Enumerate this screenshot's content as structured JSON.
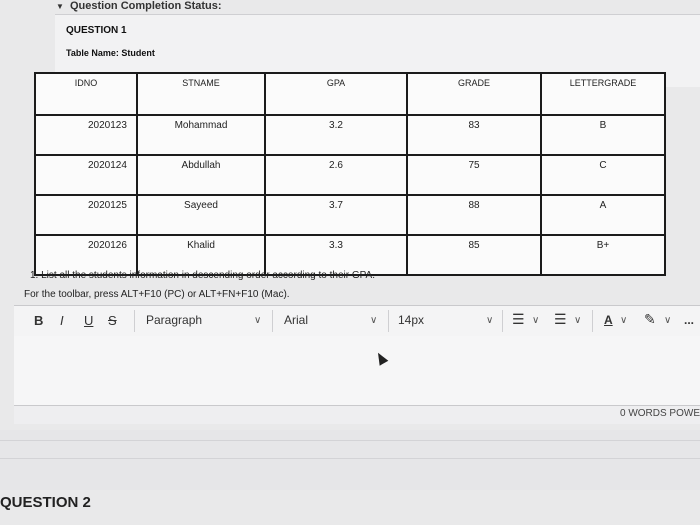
{
  "status": {
    "label": "Question Completion Status:"
  },
  "question": {
    "title": "QUESTION 1",
    "table_name": "Table Name: Student",
    "prompt": "1. List all the students information in descending order according to their GPA.",
    "toolbar_hint": "For the toolbar, press ALT+F10 (PC) or ALT+FN+F10 (Mac)."
  },
  "table": {
    "headers": [
      "IDNO",
      "STNAME",
      "GPA",
      "GRADE",
      "LETTERGRADE"
    ],
    "rows": [
      [
        "2020123",
        "Mohammad",
        "3.2",
        "83",
        "B"
      ],
      [
        "2020124",
        "Abdullah",
        "2.6",
        "75",
        "C"
      ],
      [
        "2020125",
        "Sayeed",
        "3.7",
        "88",
        "A"
      ],
      [
        "2020126",
        "Khalid",
        "3.3",
        "85",
        "B+"
      ]
    ]
  },
  "toolbar": {
    "bold": "B",
    "italic": "I",
    "underline": "U",
    "strike": "S",
    "paragraph": "Paragraph",
    "font": "Arial",
    "size": "14px",
    "more": "..."
  },
  "editor": {
    "word_count": "0 WORDS  POWE"
  },
  "next_question": "QUESTION 2"
}
